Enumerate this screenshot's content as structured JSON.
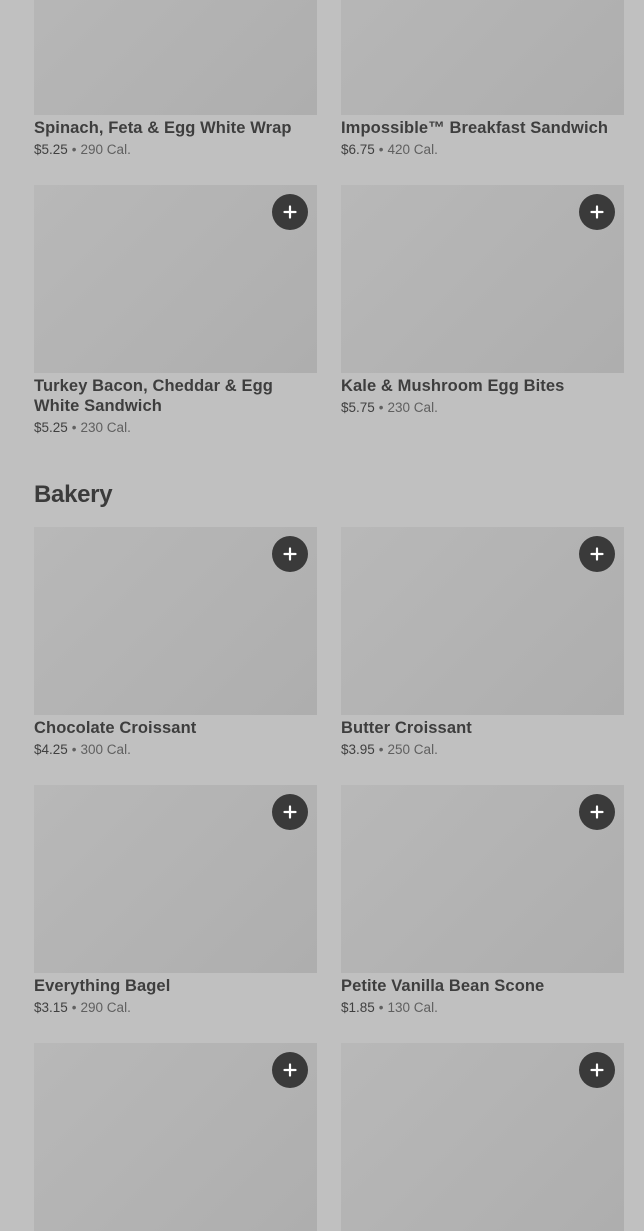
{
  "sections": [
    {
      "rows": [
        {
          "items": [
            {
              "name": "Spinach, Feta & Egg White Wrap",
              "price": "$5.25",
              "calories": "290 Cal."
            },
            {
              "name": "Impossible™ Breakfast Sandwich",
              "price": "$6.75",
              "calories": "420 Cal."
            }
          ]
        },
        {
          "items": [
            {
              "name": "Turkey Bacon, Cheddar & Egg White Sandwich",
              "price": "$5.25",
              "calories": "230 Cal."
            },
            {
              "name": "Kale & Mushroom Egg Bites",
              "price": "$5.75",
              "calories": "230 Cal."
            }
          ]
        }
      ]
    },
    {
      "title": "Bakery",
      "rows": [
        {
          "items": [
            {
              "name": "Chocolate Croissant",
              "price": "$4.25",
              "calories": "300 Cal."
            },
            {
              "name": "Butter Croissant",
              "price": "$3.95",
              "calories": "250 Cal."
            }
          ]
        },
        {
          "items": [
            {
              "name": "Everything Bagel",
              "price": "$3.15",
              "calories": "290 Cal."
            },
            {
              "name": "Petite Vanilla Bean Scone",
              "price": "$1.85",
              "calories": "130 Cal."
            }
          ]
        }
      ]
    }
  ],
  "separator": "•",
  "icons": {
    "add": "plus-icon"
  },
  "colors": {
    "background": "#c0c0c0",
    "image_placeholder": "#b3b3b3",
    "add_button": "#3a3a3a",
    "text": "#3e3e3e"
  }
}
